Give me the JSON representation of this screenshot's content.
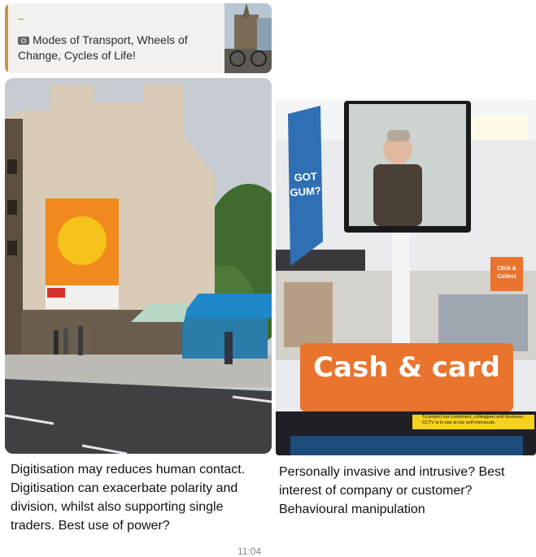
{
  "reply": {
    "author": "~",
    "text": "Modes of Transport, Wheels of Change, Cycles of Life!"
  },
  "left_message": {
    "caption": "Digitisation may reduces human contact.  Digitisation can exacerbate polarity and division, whilst also supporting single traders. Best use of power?",
    "time": "11:04"
  },
  "right_message": {
    "caption": "Personally invasive and intrusive? Best interest of company or customer? Behavioural manipulation"
  },
  "signs": {
    "cash_card": "Cash & card",
    "got_gum": "GOT GUM?",
    "click_collect": "Click & Collect",
    "cctv_notice": "To protect our customers, colleagues and business, CCTV is in use at our self-checkouts."
  },
  "colors": {
    "accent_bar": "#c8964a",
    "cash_sign": "#e8742e",
    "tent_blue": "#1e88c9"
  }
}
